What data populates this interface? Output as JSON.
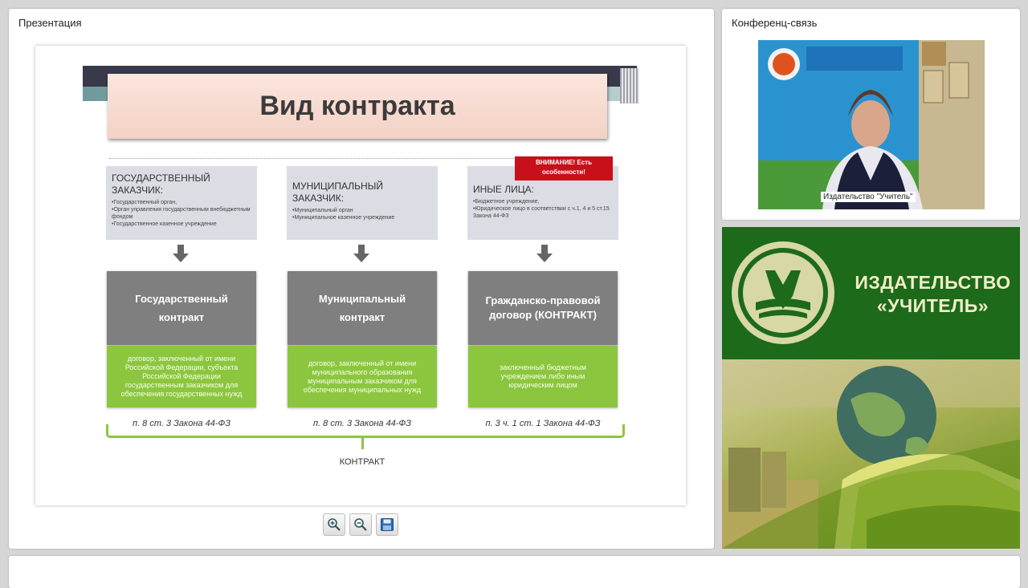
{
  "presentation": {
    "title": "Презентация",
    "slide": {
      "heading": "Вид контракта",
      "categories": [
        {
          "title": "ГОСУДАРСТВЕННЫЙ ЗАКАЗЧИК:",
          "items": [
            "•Государственный орган,",
            "•Орган управления государственным внебюджетным фондом",
            "•Государственное казенное учреждение"
          ]
        },
        {
          "title": "МУНИЦИПАЛЬНЫЙ ЗАКАЗЧИК:",
          "items": [
            "•Муниципальный орган",
            "•Муниципальное казенное учреждение"
          ]
        },
        {
          "title": "ИНЫЕ ЛИЦА:",
          "items": [
            "•Бюджетное учреждение,",
            "•Юридическое лицо в соответствии с ч.1, 4 и 5 ст.15 Закона 44-ФЗ"
          ]
        }
      ],
      "warning": "ВНИМАНИЕ! Есть особенности!",
      "contracts": [
        {
          "name": "Государственный контракт",
          "desc": "договор, заключенный от имени Российской Федерации, субъекта Российской Федерации государственным заказчиком для обеспечения государственных нужд",
          "law": "п. 8 ст. 3 Закона 44-ФЗ"
        },
        {
          "name": "Муниципальный контракт",
          "desc": "договор, заключенный от имени муниципального образования муниципальным заказчиком для обеспечения муниципальных нужд",
          "law": "п. 8 ст. 3 Закона 44-ФЗ"
        },
        {
          "name": "Гражданско-правовой договор (КОНТРАКТ)",
          "desc": "заключенный бюджетным учреждением либо иным юридическим лицом",
          "law": "п. 3  ч. 1 ст. 1 Закона 44-ФЗ"
        }
      ],
      "summary": "КОНТРАКТ"
    },
    "toolbar": {
      "icons": [
        "zoom-in-icon",
        "zoom-out-icon",
        "save-icon"
      ]
    }
  },
  "conference": {
    "title": "Конференц-связь",
    "video_label": "Издательство \"Учитель\""
  },
  "banner": {
    "line1": "ИЗДАТЕЛЬСТВО",
    "line2": "«УЧИТЕЛЬ»"
  },
  "colors": {
    "green": "#8cc63f",
    "gray": "#7f7f7f",
    "warning": "#c8101a",
    "banner": "#1c6a1a"
  }
}
